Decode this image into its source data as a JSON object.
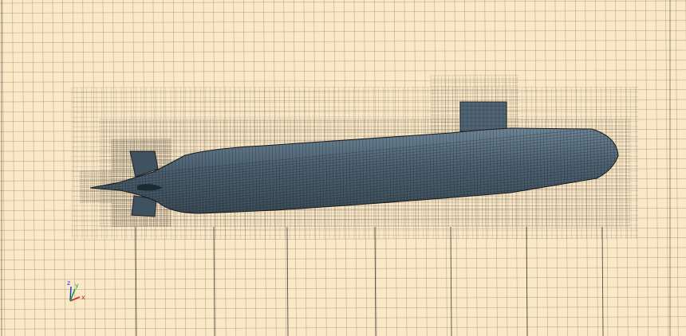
{
  "viewport": {
    "background_color": "#fbe8c6",
    "mesh_line_color": "#1a1a1a",
    "hull_color": "#4c6272"
  },
  "triad": {
    "x_label": "x",
    "x_color": "#d42020",
    "y_label": "y",
    "y_color": "#1c9a2a",
    "z_label": "z",
    "z_color": "#2040d0"
  }
}
